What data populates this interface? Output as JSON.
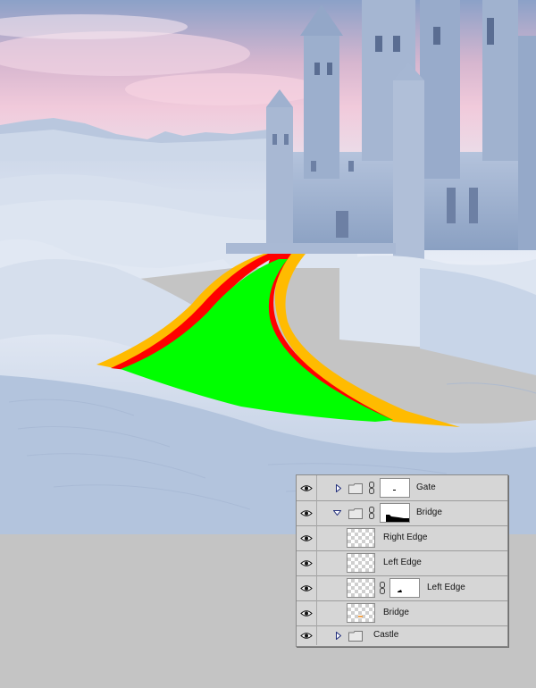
{
  "colors": {
    "bridge_fill": "#00ff00",
    "left_edge": "#ff0000",
    "right_edge": "#ffbb00",
    "panel_bg": "#d6d6d6",
    "canvas_gray": "#c4c4c4"
  },
  "layers": [
    {
      "label": "Gate",
      "type": "group",
      "expanded": false,
      "has_mask": true,
      "visible": true
    },
    {
      "label": "Bridge",
      "type": "group",
      "expanded": true,
      "has_mask": true,
      "visible": true
    },
    {
      "label": "Right Edge",
      "type": "layer",
      "visible": true
    },
    {
      "label": "Left Edge",
      "type": "layer",
      "visible": true
    },
    {
      "label": "Left Edge",
      "type": "layer",
      "has_mask": true,
      "visible": true
    },
    {
      "label": "Bridge",
      "type": "layer",
      "visible": true
    },
    {
      "label": "Castle",
      "type": "group",
      "expanded": false,
      "visible": true
    }
  ]
}
